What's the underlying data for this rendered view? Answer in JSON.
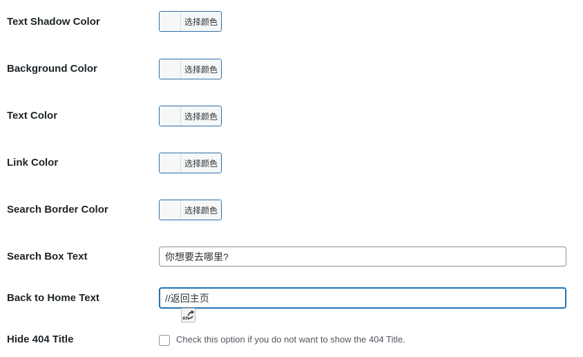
{
  "settings": {
    "color_fields": [
      {
        "label": "Text Shadow Color",
        "button_text": "选择颜色"
      },
      {
        "label": "Background Color",
        "button_text": "选择颜色"
      },
      {
        "label": "Text Color",
        "button_text": "选择颜色"
      },
      {
        "label": "Link Color",
        "button_text": "选择颜色"
      },
      {
        "label": "Search Border Color",
        "button_text": "选择颜色"
      }
    ],
    "search_box": {
      "label": "Search Box Text",
      "value": "你想要去哪里?"
    },
    "back_home": {
      "label": "Back to Home Text",
      "value": "//返回主页"
    },
    "hide_title": {
      "label": "Hide 404 Title",
      "checked": false,
      "description": "Check this option if you do not want to show the 404 Title."
    }
  },
  "colors": {
    "focus_border": "#2271b1",
    "button_border": "#2c6fa8",
    "button_bg": "#f6f7f7"
  },
  "icons": {
    "ime_indicator": "ime-language-icon"
  }
}
